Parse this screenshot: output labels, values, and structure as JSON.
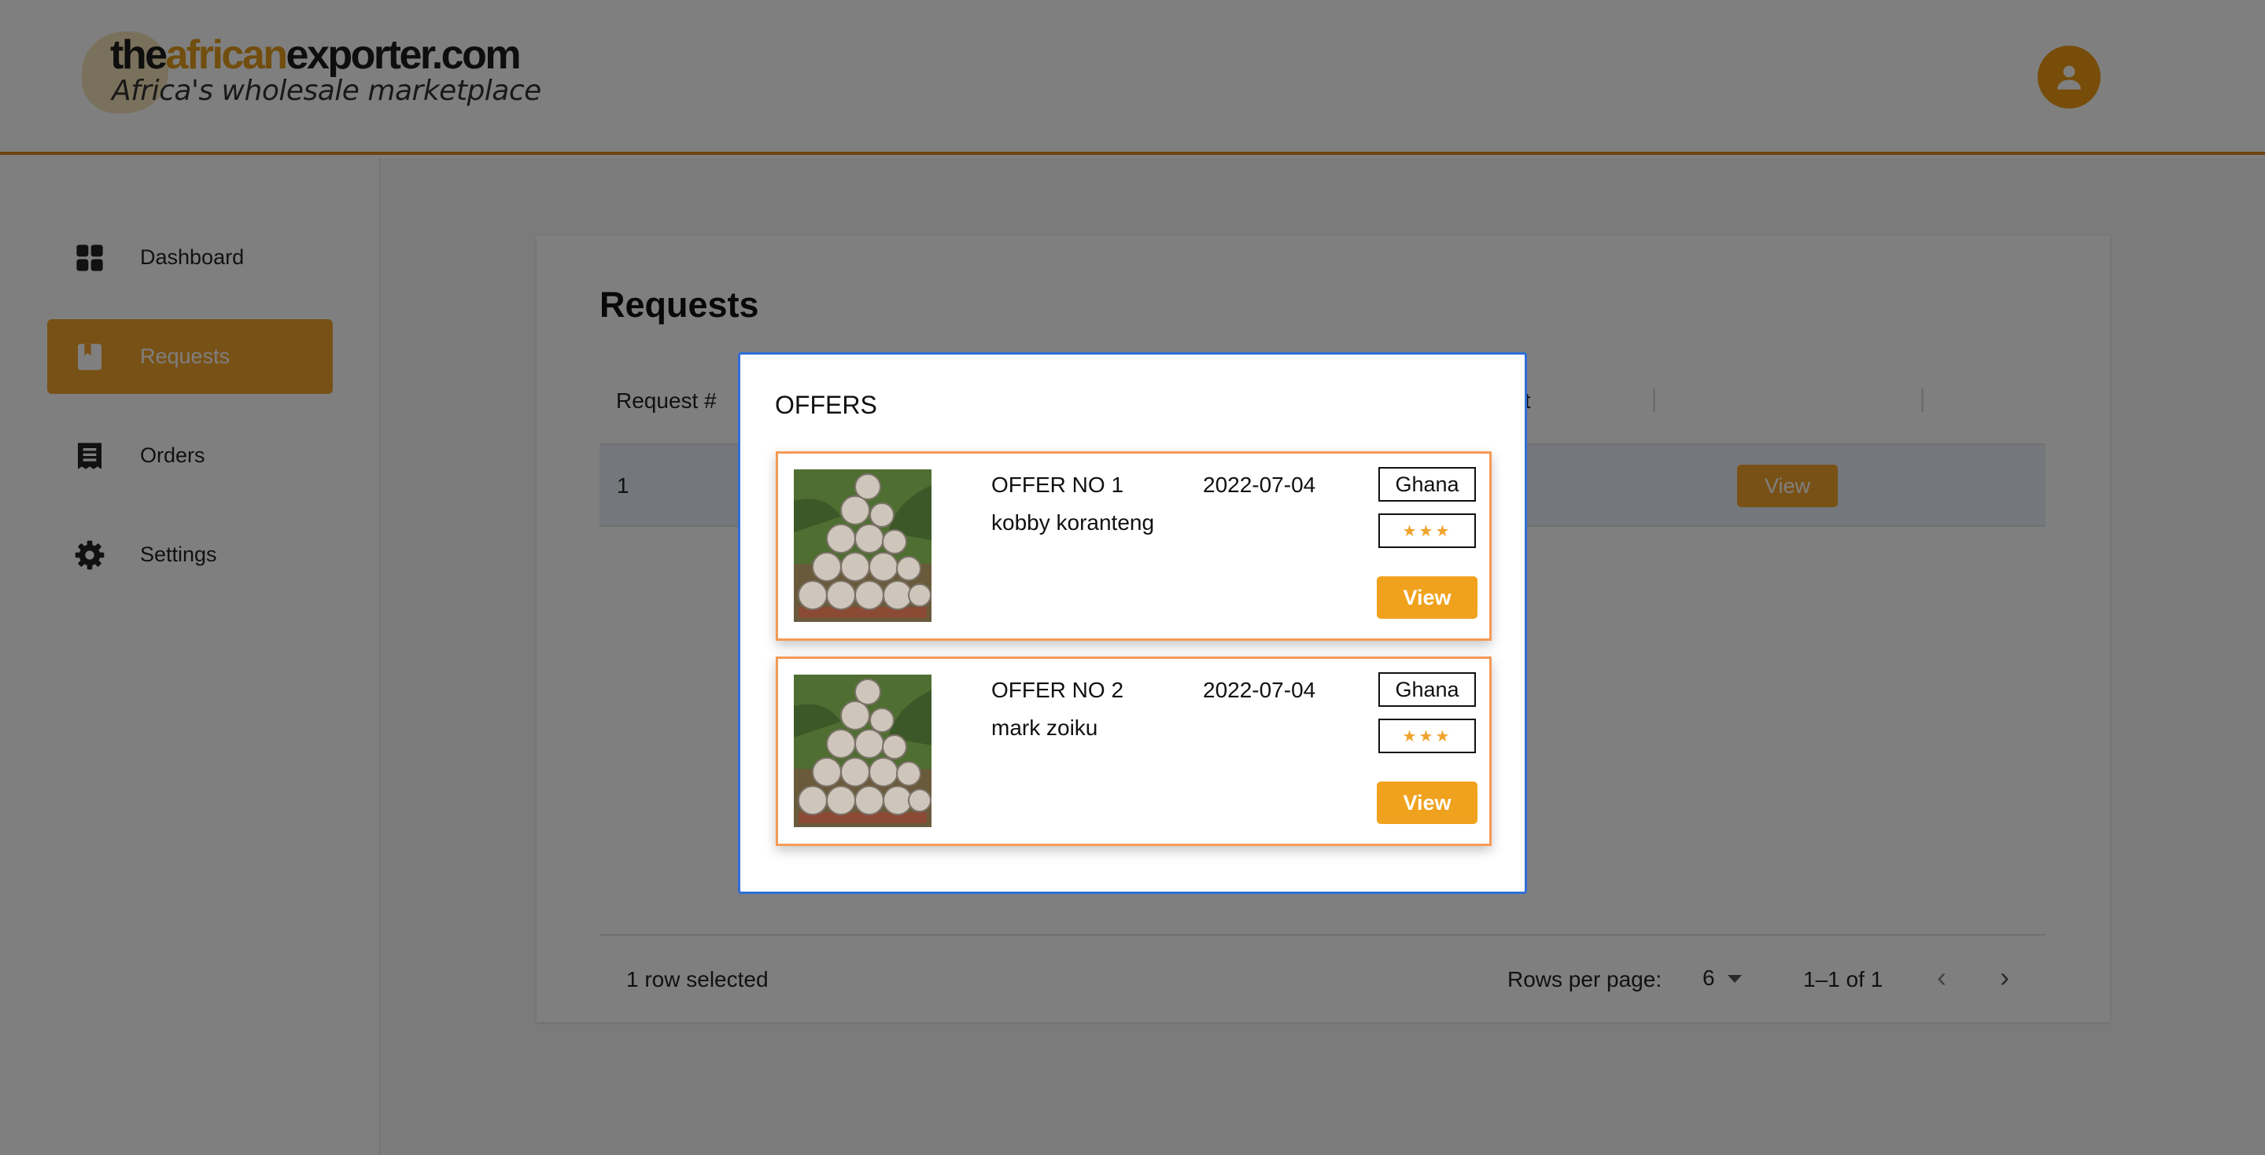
{
  "brand": {
    "name_part1": "the",
    "name_part2": "african",
    "name_part3": "exporter.com",
    "tagline": "Africa's wholesale marketplace",
    "accent_color": "#f0a22c"
  },
  "header": {
    "user_icon": "account-circle-icon"
  },
  "sidebar": {
    "items": [
      {
        "label": "Dashboard",
        "icon": "dashboard-icon",
        "active": false
      },
      {
        "label": "Requests",
        "icon": "book-icon",
        "active": true
      },
      {
        "label": "Orders",
        "icon": "receipt-icon",
        "active": false
      },
      {
        "label": "Settings",
        "icon": "gear-icon",
        "active": false
      }
    ]
  },
  "main": {
    "title": "Requests",
    "table": {
      "columns": [
        "Request #",
        "ft",
        "",
        ""
      ],
      "rows": [
        {
          "id": "1",
          "action": "View",
          "selected": true
        }
      ]
    },
    "footer": {
      "selection": "1 row selected",
      "rows_per_page_label": "Rows per page:",
      "rows_per_page_value": "6",
      "range": "1–1 of 1"
    }
  },
  "modal": {
    "title": "OFFERS",
    "offers": [
      {
        "number": "OFFER NO 1",
        "date": "2022-07-04",
        "seller": "kobby koranteng",
        "country": "Ghana",
        "rating": "★★★",
        "action": "View"
      },
      {
        "number": "OFFER NO 2",
        "date": "2022-07-04",
        "seller": "mark zoiku",
        "country": "Ghana",
        "rating": "★★★",
        "action": "View"
      }
    ]
  }
}
